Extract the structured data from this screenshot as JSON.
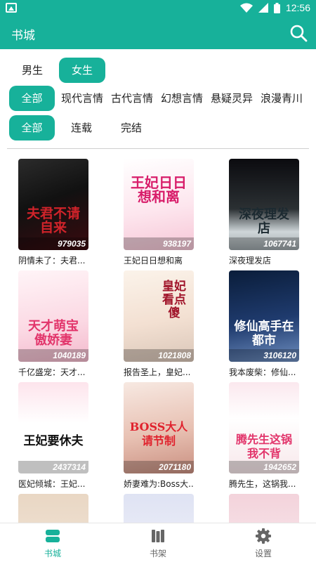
{
  "status_bar": {
    "time": "12:56",
    "icons": [
      "image-icon",
      "wifi-icon",
      "signal-icon",
      "battery-icon"
    ]
  },
  "app_bar": {
    "title": "书城",
    "search_icon": "search-icon"
  },
  "gender_tabs": [
    {
      "label": "男生",
      "active": false
    },
    {
      "label": "女生",
      "active": true
    }
  ],
  "categories": [
    {
      "label": "全部",
      "active": true
    },
    {
      "label": "现代言情",
      "active": false
    },
    {
      "label": "古代言情",
      "active": false
    },
    {
      "label": "幻想言情",
      "active": false
    },
    {
      "label": "悬疑灵异",
      "active": false
    },
    {
      "label": "浪漫青川",
      "active": false
    }
  ],
  "status_filters": [
    {
      "label": "全部",
      "active": true
    },
    {
      "label": "连载",
      "active": false
    },
    {
      "label": "完结",
      "active": false
    }
  ],
  "books": [
    {
      "name": "阴情未了：夫君...",
      "count": "979035",
      "cover_text": "夫君不请自来"
    },
    {
      "name": "王妃日日想和离",
      "count": "938197",
      "cover_text": "王妃日日想和离"
    },
    {
      "name": "深夜理发店",
      "count": "1067741",
      "cover_text": "深夜理发店"
    },
    {
      "name": "千亿盛宠：天才...",
      "count": "1040189",
      "cover_text": "天才萌宝傲娇妻"
    },
    {
      "name": "报告圣上，皇妃...",
      "count": "1021808",
      "cover_text": "皇妃看点傻"
    },
    {
      "name": "我本废柴：修仙...",
      "count": "3106120",
      "cover_text": "修仙高手在都市"
    },
    {
      "name": "医妃倾城：王妃...",
      "count": "2437314",
      "cover_text": "王妃要休夫"
    },
    {
      "name": "娇妻难为:Boss大...",
      "count": "2071180",
      "cover_text": "BOSS大人请节制"
    },
    {
      "name": "腾先生，这锅我...",
      "count": "1942652",
      "cover_text": "腾先生这锅我不背"
    },
    {
      "name": "",
      "count": "",
      "cover_text": ""
    },
    {
      "name": "",
      "count": "",
      "cover_text": ""
    },
    {
      "name": "",
      "count": "",
      "cover_text": ""
    }
  ],
  "bottom_tabs": [
    {
      "label": "书城",
      "icon": "bookstore-icon",
      "active": true
    },
    {
      "label": "书架",
      "icon": "bookshelf-icon",
      "active": false
    },
    {
      "label": "设置",
      "icon": "gear-icon",
      "active": false
    }
  ],
  "colors": {
    "accent": "#17b19a",
    "text": "#222222",
    "divider": "#cfcfcf"
  }
}
